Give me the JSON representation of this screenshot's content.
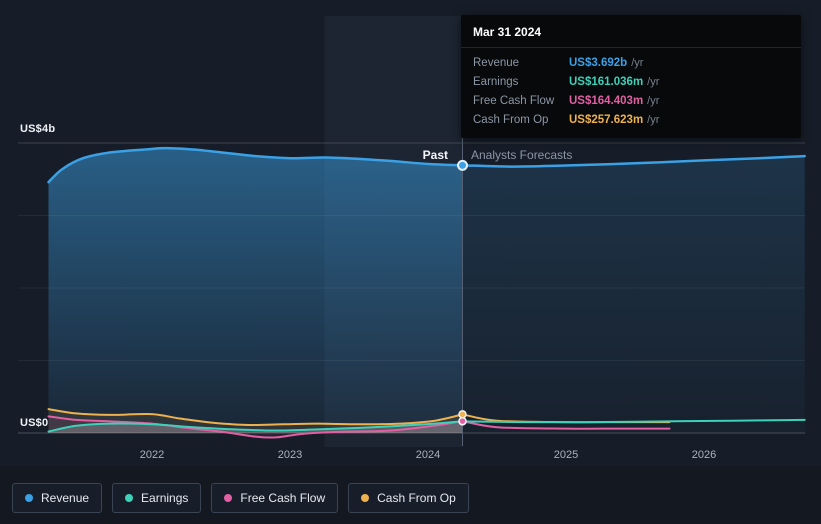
{
  "tooltip": {
    "date": "Mar 31 2024",
    "rows": [
      {
        "label": "Revenue",
        "value": "US$3.692b",
        "suffix": "/yr",
        "color": "#3ba1e6"
      },
      {
        "label": "Earnings",
        "value": "US$161.036m",
        "suffix": "/yr",
        "color": "#3ed0b9"
      },
      {
        "label": "Free Cash Flow",
        "value": "US$164.403m",
        "suffix": "/yr",
        "color": "#e25fa4"
      },
      {
        "label": "Cash From Op",
        "value": "US$257.623m",
        "suffix": "/yr",
        "color": "#edb24d"
      }
    ]
  },
  "axis": {
    "y_top_label": "US$4b",
    "y_zero_label": "US$0",
    "x_ticks": [
      "2022",
      "2023",
      "2024",
      "2025",
      "2026"
    ]
  },
  "divider": {
    "past_label": "Past",
    "forecast_label": "Analysts Forecasts"
  },
  "legend": {
    "items": [
      {
        "label": "Revenue",
        "color": "#3ba1e6"
      },
      {
        "label": "Earnings",
        "color": "#3ed0b9"
      },
      {
        "label": "Free Cash Flow",
        "color": "#e25fa4"
      },
      {
        "label": "Cash From Op",
        "color": "#edb24d"
      }
    ]
  },
  "chart_data": {
    "type": "line",
    "x_range": [
      2021.25,
      2026.73
    ],
    "y_range_billions": [
      -0.15,
      4.0
    ],
    "divider_x": 2024.25,
    "gridlines_billions": [
      0,
      1,
      2,
      3,
      4
    ],
    "legend_position": "bottom-left",
    "series": [
      {
        "name": "Revenue",
        "color": "#3ba1e6",
        "width": 2.5,
        "past": [
          [
            2021.25,
            3.46
          ],
          [
            2021.35,
            3.64
          ],
          [
            2021.5,
            3.79
          ],
          [
            2021.7,
            3.87
          ],
          [
            2021.95,
            3.91
          ],
          [
            2022.1,
            3.93
          ],
          [
            2022.3,
            3.91
          ],
          [
            2022.5,
            3.87
          ],
          [
            2022.75,
            3.82
          ],
          [
            2023.0,
            3.79
          ],
          [
            2023.25,
            3.8
          ],
          [
            2023.5,
            3.78
          ],
          [
            2023.75,
            3.75
          ],
          [
            2024.0,
            3.71
          ],
          [
            2024.25,
            3.692
          ]
        ],
        "forecast": [
          [
            2024.25,
            3.692
          ],
          [
            2024.6,
            3.675
          ],
          [
            2025.0,
            3.69
          ],
          [
            2025.5,
            3.72
          ],
          [
            2026.0,
            3.76
          ],
          [
            2026.4,
            3.79
          ],
          [
            2026.73,
            3.82
          ]
        ]
      },
      {
        "name": "Cash From Op",
        "color": "#edb24d",
        "width": 2,
        "past": [
          [
            2021.25,
            0.33
          ],
          [
            2021.45,
            0.27
          ],
          [
            2021.7,
            0.25
          ],
          [
            2022.0,
            0.26
          ],
          [
            2022.2,
            0.2
          ],
          [
            2022.45,
            0.14
          ],
          [
            2022.7,
            0.11
          ],
          [
            2022.95,
            0.12
          ],
          [
            2023.2,
            0.13
          ],
          [
            2023.5,
            0.12
          ],
          [
            2023.8,
            0.13
          ],
          [
            2024.05,
            0.17
          ],
          [
            2024.25,
            0.2576
          ]
        ],
        "forecast": [
          [
            2024.25,
            0.2576
          ],
          [
            2024.5,
            0.17
          ],
          [
            2025.0,
            0.15
          ],
          [
            2025.4,
            0.15
          ],
          [
            2025.75,
            0.15
          ]
        ]
      },
      {
        "name": "Free Cash Flow",
        "color": "#e25fa4",
        "width": 2,
        "past": [
          [
            2021.25,
            0.23
          ],
          [
            2021.45,
            0.18
          ],
          [
            2021.7,
            0.16
          ],
          [
            2022.0,
            0.13
          ],
          [
            2022.25,
            0.07
          ],
          [
            2022.5,
            0.02
          ],
          [
            2022.75,
            -0.05
          ],
          [
            2022.9,
            -0.06
          ],
          [
            2023.1,
            -0.01
          ],
          [
            2023.4,
            0.02
          ],
          [
            2023.7,
            0.03
          ],
          [
            2024.0,
            0.09
          ],
          [
            2024.25,
            0.1644
          ]
        ],
        "forecast": [
          [
            2024.25,
            0.1644
          ],
          [
            2024.5,
            0.08
          ],
          [
            2025.0,
            0.06
          ],
          [
            2025.4,
            0.06
          ],
          [
            2025.75,
            0.06
          ]
        ]
      },
      {
        "name": "Earnings",
        "color": "#3ed0b9",
        "width": 2,
        "past": [
          [
            2021.25,
            0.02
          ],
          [
            2021.45,
            0.1
          ],
          [
            2021.7,
            0.13
          ],
          [
            2022.0,
            0.12
          ],
          [
            2022.3,
            0.08
          ],
          [
            2022.6,
            0.05
          ],
          [
            2022.9,
            0.035
          ],
          [
            2023.2,
            0.05
          ],
          [
            2023.5,
            0.07
          ],
          [
            2023.8,
            0.1
          ],
          [
            2024.05,
            0.13
          ],
          [
            2024.25,
            0.161
          ]
        ],
        "forecast": [
          [
            2024.25,
            0.161
          ],
          [
            2024.7,
            0.15
          ],
          [
            2025.2,
            0.15
          ],
          [
            2025.7,
            0.16
          ],
          [
            2026.2,
            0.17
          ],
          [
            2026.73,
            0.18
          ]
        ]
      }
    ]
  }
}
